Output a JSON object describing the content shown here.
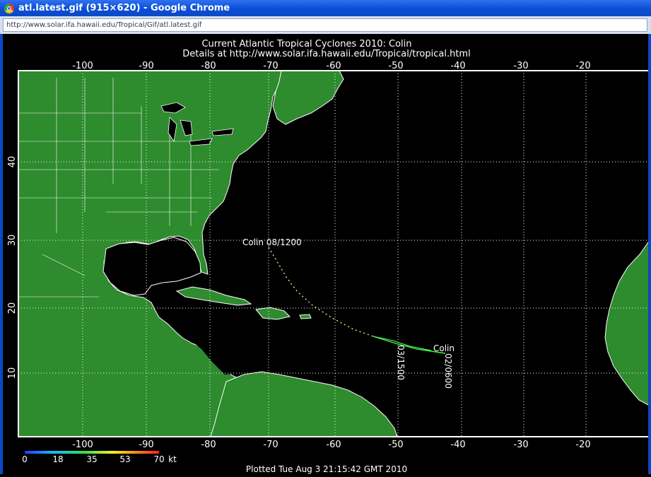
{
  "window": {
    "title": "atl.latest.gif (915×620) - Google Chrome",
    "url": "http://www.solar.ifa.hawaii.edu/Tropical/Gif/atl.latest.gif"
  },
  "map": {
    "title_line1": "Current Atlantic Tropical Cyclones 2010: Colin",
    "title_line2": "Details at http://www.solar.ifa.hawaii.edu/Tropical/tropical.html",
    "lon_ticks": [
      "-100",
      "-90",
      "-80",
      "-70",
      "-60",
      "-50",
      "-40",
      "-30",
      "-20"
    ],
    "lat_ticks": [
      "40",
      "30",
      "20",
      "10"
    ],
    "storm_label": "Colin 08/1200",
    "track_label_1": "03/1500",
    "track_label_2": "Colin",
    "track_label_3": "02/0600",
    "scale_labels": [
      "0",
      "18",
      "35",
      "53",
      "70"
    ],
    "scale_unit": "kt",
    "footer": "Plotted Tue Aug 3 21:15:42 GMT 2010"
  },
  "colors": {
    "land": "#2e8b2e",
    "ocean": "#000000",
    "coast": "#ffffff",
    "grid": "#ffffff"
  }
}
